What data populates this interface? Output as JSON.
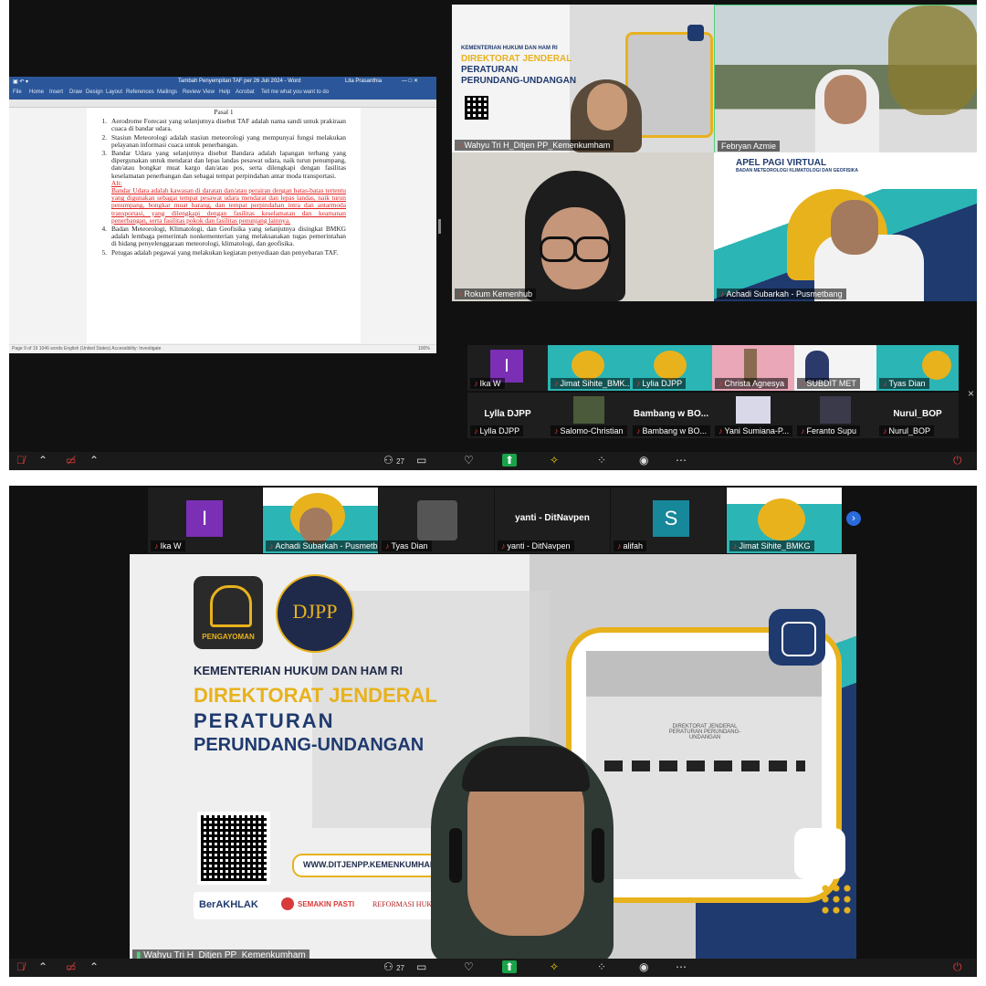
{
  "top": {
    "word": {
      "title": "Tambah Penyempitan TAF per 26 Juli 2024 - Word",
      "user": "Lita Prasanthia",
      "menu": [
        "File",
        "Home",
        "Insert",
        "Draw",
        "Design",
        "Layout",
        "References",
        "Mailings",
        "Review",
        "View",
        "Help",
        "Acrobat",
        "Tell me what you want to do"
      ],
      "status": "Page 9 of 19   1046 words   English (United States)   Accessibility: Investigate",
      "zoom": "100%",
      "pasal": "Pasal 1",
      "items": [
        {
          "n": "1.",
          "text": "Aerodrome Forecast yang selanjutnya disebut TAF adalah nama sandi untuk prakiraan cuaca di bandar udara."
        },
        {
          "n": "2.",
          "text": "Stasiun Meteorologi adalah stasiun meteorologi yang mempunyai fungsi melakukan pelayanan informasi cuaca untuk penerbangan."
        },
        {
          "n": "3.",
          "text": "Bandar Udara yang selanjutnya disebut Bandara adalah lapangan terbang yang dipergunakan untuk mendarat dan lepas landas pesawat udara, naik turun penumpang, dan/atau bongkar muat kargo dan/atau pos, serta dilengkapi dengan fasilitas keselamatan penerbangan dan sebagai tempat perpindahan antar moda transportasi."
        },
        {
          "n": "4.",
          "text": "Badan Meteorologi, Klimatologi, dan Geofisika yang selanjutnya disingkat BMKG adalah lembaga pemerintah nonkementerian yang melaksanakan tugas pemerintahan di bidang penyelenggaraan meteorologi, klimatologi, dan geofisika."
        },
        {
          "n": "5.",
          "text": "Petugas adalah pegawai yang melakukan kegiatan penyediaan dan penyebaran TAF."
        }
      ],
      "alt_label": "Alt:",
      "alt_text": "Bandar Udara adalah kawasan di daratan dan/atau perairan dengan batas-batas tertentu yang digunakan sebagai tempat pesawat udara mendarat dan lepas landas, naik turun penumpang, bongkar muat barang, dan tempat perpindahan intra dan antarmoda transportasi, yang dilengkapi dengan fasilitas keselamatan dan keamanan penerbangan, serta fasilitas pokok dan fasilitas penunjang lainnya."
    },
    "videos": [
      {
        "name": "Wahyu Tri H_Ditjen PP_Kemenkumham"
      },
      {
        "name": "Febryan Azmie"
      },
      {
        "name": "Rokum Kemenhub"
      },
      {
        "name": "Achadi Subarkah - Pusmetbang"
      }
    ],
    "bmkg_banner": {
      "title": "APEL PAGI VIRTUAL",
      "subtitle": "BADAN METEOROLOGI KLIMATOLOGI DAN GEOFISIKA"
    },
    "strip_row1": [
      {
        "name": "Ika W",
        "initial": "I"
      },
      {
        "name": "Jimat Sihite_BMK..."
      },
      {
        "name": "Lylia DJPP"
      },
      {
        "name": "Christa Agnesya"
      },
      {
        "name": "SUBDIT MET"
      },
      {
        "name": "Tyas Dian"
      }
    ],
    "strip_row2": [
      {
        "label": "Lylla DJPP",
        "name": "Lylla DJPP"
      },
      {
        "name": "Salomo-Christian"
      },
      {
        "label": "Bambang w BO...",
        "name": "Bambang w BO..."
      },
      {
        "name": "Yani Sumiana-P..."
      },
      {
        "name": "Feranto Supu"
      },
      {
        "label": "Nurul_BOP",
        "name": "Nurul_BOP"
      }
    ],
    "toolbar": {
      "participants": "27"
    }
  },
  "bottom": {
    "strip": [
      {
        "name": "Ika W",
        "initial": "I"
      },
      {
        "name": "Achadi Subarkah - Pusmetbang"
      },
      {
        "name": "Tyas Dian"
      },
      {
        "label": "yanti - DitNavpen",
        "name": "yanti - DitNavpen"
      },
      {
        "name": "alifah",
        "initial": "S"
      },
      {
        "name": "Jimat Sihite_BMKG"
      }
    ],
    "banner": {
      "logo1_label": "PENGAYOMAN",
      "logo2_label": "DJPP",
      "line1": "KEMENTERIAN HUKUM DAN HAM RI",
      "line2": "DIREKTORAT JENDERAL",
      "line3": "PERATURAN",
      "line4": "PERUNDANG-UNDANGAN",
      "website": "WWW.DITJENPP.KEMENKUMHAM...",
      "logos": [
        "BerAKHLAK",
        "SEMAKIN PASTI",
        "REFORMASI HUKUM"
      ],
      "building_sign": "DIREKTORAT JENDERAL PERATURAN PERUNDANG-UNDANGAN"
    },
    "speaker": "Wahyu Tri H_Ditjen PP_Kemenkumham",
    "toolbar": {
      "participants": "27"
    },
    "colors": {
      "navy": "#1f3a6e",
      "gold": "#e8b21d",
      "teal": "#2bb5b5"
    }
  }
}
